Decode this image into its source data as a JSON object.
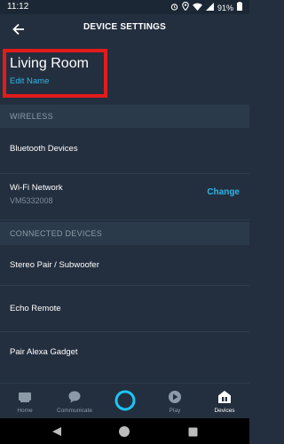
{
  "status_bar": {
    "time": "11:12",
    "battery": "91%",
    "icons": [
      "alarm-icon",
      "location-icon",
      "wifi-icon",
      "signal-icon",
      "battery-icon"
    ]
  },
  "app_bar": {
    "title": "DEVICE SETTINGS",
    "back_icon": "arrow-left-icon"
  },
  "device": {
    "name": "Living Room",
    "edit_label": "Edit Name"
  },
  "sections": {
    "wireless": {
      "header": "WIRELESS",
      "items": [
        {
          "label": "Bluetooth Devices"
        },
        {
          "label": "Wi-Fi Network",
          "sub": "VM5332008",
          "action": "Change"
        }
      ]
    },
    "connected": {
      "header": "CONNECTED DEVICES",
      "items": [
        {
          "label": "Stereo Pair / Subwoofer"
        },
        {
          "label": "Echo Remote"
        },
        {
          "label": "Pair Alexa Gadget"
        }
      ]
    }
  },
  "bottom_nav": {
    "items": [
      {
        "label": "Home",
        "icon": "home-icon",
        "active": false
      },
      {
        "label": "Communicate",
        "icon": "chat-bubble-icon",
        "active": false
      },
      {
        "label": "",
        "icon": "alexa-ring-icon",
        "active": false
      },
      {
        "label": "Play",
        "icon": "play-icon",
        "active": false
      },
      {
        "label": "Devices",
        "icon": "devices-icon",
        "active": true
      }
    ]
  },
  "colors": {
    "background": "#232F3E",
    "section_header_bg": "#2B3A4A",
    "accent": "#2FB6E8",
    "highlight": "#E21B1B",
    "alexa": "#1FC4F4"
  }
}
